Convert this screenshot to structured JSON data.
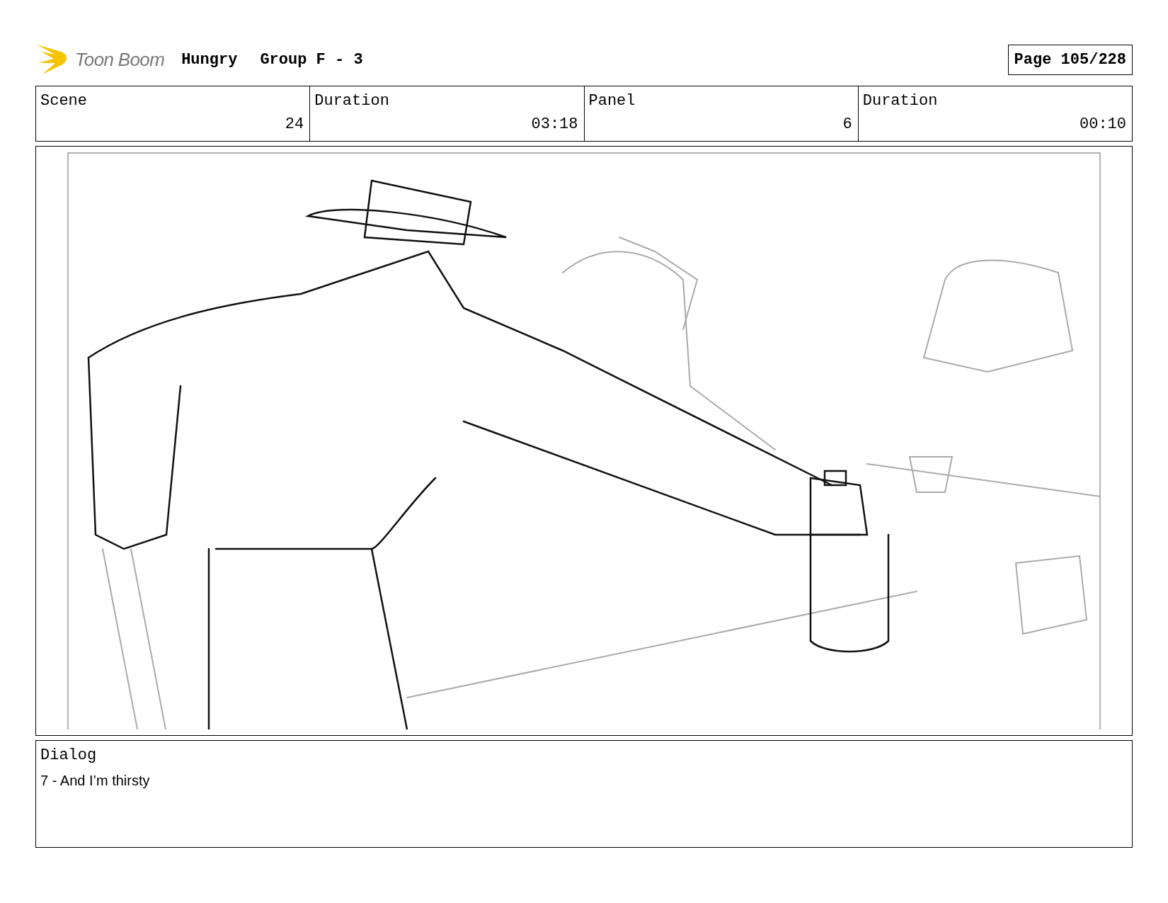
{
  "header": {
    "logo_text": "Toon Boom",
    "project": "Hungry",
    "sequence": "Group F - 3",
    "page": "Page 105/228"
  },
  "info_bar": {
    "labels": [
      "Scene",
      "Duration",
      "Panel",
      "Duration"
    ],
    "values": [
      "24",
      "03:18",
      "6",
      "00:10"
    ]
  },
  "dialog": {
    "label": "Dialog",
    "text": "7 - And I’m thirsty"
  }
}
